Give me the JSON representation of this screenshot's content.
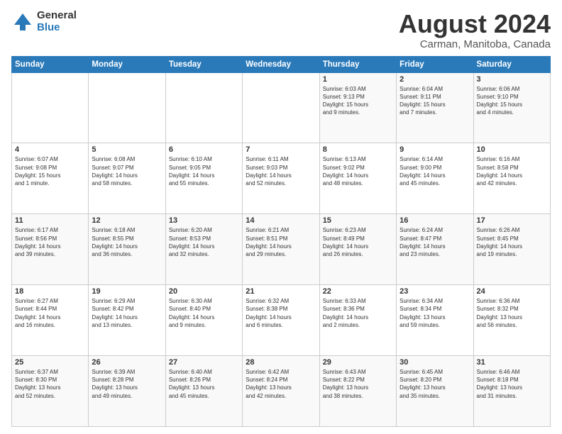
{
  "header": {
    "logo_general": "General",
    "logo_blue": "Blue",
    "main_title": "August 2024",
    "subtitle": "Carman, Manitoba, Canada"
  },
  "calendar": {
    "days_of_week": [
      "Sunday",
      "Monday",
      "Tuesday",
      "Wednesday",
      "Thursday",
      "Friday",
      "Saturday"
    ],
    "weeks": [
      [
        {
          "day": "",
          "info": ""
        },
        {
          "day": "",
          "info": ""
        },
        {
          "day": "",
          "info": ""
        },
        {
          "day": "",
          "info": ""
        },
        {
          "day": "1",
          "info": "Sunrise: 6:03 AM\nSunset: 9:13 PM\nDaylight: 15 hours\nand 9 minutes."
        },
        {
          "day": "2",
          "info": "Sunrise: 6:04 AM\nSunset: 9:11 PM\nDaylight: 15 hours\nand 7 minutes."
        },
        {
          "day": "3",
          "info": "Sunrise: 6:06 AM\nSunset: 9:10 PM\nDaylight: 15 hours\nand 4 minutes."
        }
      ],
      [
        {
          "day": "4",
          "info": "Sunrise: 6:07 AM\nSunset: 9:08 PM\nDaylight: 15 hours\nand 1 minute."
        },
        {
          "day": "5",
          "info": "Sunrise: 6:08 AM\nSunset: 9:07 PM\nDaylight: 14 hours\nand 58 minutes."
        },
        {
          "day": "6",
          "info": "Sunrise: 6:10 AM\nSunset: 9:05 PM\nDaylight: 14 hours\nand 55 minutes."
        },
        {
          "day": "7",
          "info": "Sunrise: 6:11 AM\nSunset: 9:03 PM\nDaylight: 14 hours\nand 52 minutes."
        },
        {
          "day": "8",
          "info": "Sunrise: 6:13 AM\nSunset: 9:02 PM\nDaylight: 14 hours\nand 48 minutes."
        },
        {
          "day": "9",
          "info": "Sunrise: 6:14 AM\nSunset: 9:00 PM\nDaylight: 14 hours\nand 45 minutes."
        },
        {
          "day": "10",
          "info": "Sunrise: 6:16 AM\nSunset: 8:58 PM\nDaylight: 14 hours\nand 42 minutes."
        }
      ],
      [
        {
          "day": "11",
          "info": "Sunrise: 6:17 AM\nSunset: 8:56 PM\nDaylight: 14 hours\nand 39 minutes."
        },
        {
          "day": "12",
          "info": "Sunrise: 6:18 AM\nSunset: 8:55 PM\nDaylight: 14 hours\nand 36 minutes."
        },
        {
          "day": "13",
          "info": "Sunrise: 6:20 AM\nSunset: 8:53 PM\nDaylight: 14 hours\nand 32 minutes."
        },
        {
          "day": "14",
          "info": "Sunrise: 6:21 AM\nSunset: 8:51 PM\nDaylight: 14 hours\nand 29 minutes."
        },
        {
          "day": "15",
          "info": "Sunrise: 6:23 AM\nSunset: 8:49 PM\nDaylight: 14 hours\nand 26 minutes."
        },
        {
          "day": "16",
          "info": "Sunrise: 6:24 AM\nSunset: 8:47 PM\nDaylight: 14 hours\nand 23 minutes."
        },
        {
          "day": "17",
          "info": "Sunrise: 6:26 AM\nSunset: 8:45 PM\nDaylight: 14 hours\nand 19 minutes."
        }
      ],
      [
        {
          "day": "18",
          "info": "Sunrise: 6:27 AM\nSunset: 8:44 PM\nDaylight: 14 hours\nand 16 minutes."
        },
        {
          "day": "19",
          "info": "Sunrise: 6:29 AM\nSunset: 8:42 PM\nDaylight: 14 hours\nand 13 minutes."
        },
        {
          "day": "20",
          "info": "Sunrise: 6:30 AM\nSunset: 8:40 PM\nDaylight: 14 hours\nand 9 minutes."
        },
        {
          "day": "21",
          "info": "Sunrise: 6:32 AM\nSunset: 8:38 PM\nDaylight: 14 hours\nand 6 minutes."
        },
        {
          "day": "22",
          "info": "Sunrise: 6:33 AM\nSunset: 8:36 PM\nDaylight: 14 hours\nand 2 minutes."
        },
        {
          "day": "23",
          "info": "Sunrise: 6:34 AM\nSunset: 8:34 PM\nDaylight: 13 hours\nand 59 minutes."
        },
        {
          "day": "24",
          "info": "Sunrise: 6:36 AM\nSunset: 8:32 PM\nDaylight: 13 hours\nand 56 minutes."
        }
      ],
      [
        {
          "day": "25",
          "info": "Sunrise: 6:37 AM\nSunset: 8:30 PM\nDaylight: 13 hours\nand 52 minutes."
        },
        {
          "day": "26",
          "info": "Sunrise: 6:39 AM\nSunset: 8:28 PM\nDaylight: 13 hours\nand 49 minutes."
        },
        {
          "day": "27",
          "info": "Sunrise: 6:40 AM\nSunset: 8:26 PM\nDaylight: 13 hours\nand 45 minutes."
        },
        {
          "day": "28",
          "info": "Sunrise: 6:42 AM\nSunset: 8:24 PM\nDaylight: 13 hours\nand 42 minutes."
        },
        {
          "day": "29",
          "info": "Sunrise: 6:43 AM\nSunset: 8:22 PM\nDaylight: 13 hours\nand 38 minutes."
        },
        {
          "day": "30",
          "info": "Sunrise: 6:45 AM\nSunset: 8:20 PM\nDaylight: 13 hours\nand 35 minutes."
        },
        {
          "day": "31",
          "info": "Sunrise: 6:46 AM\nSunset: 8:18 PM\nDaylight: 13 hours\nand 31 minutes."
        }
      ]
    ]
  }
}
